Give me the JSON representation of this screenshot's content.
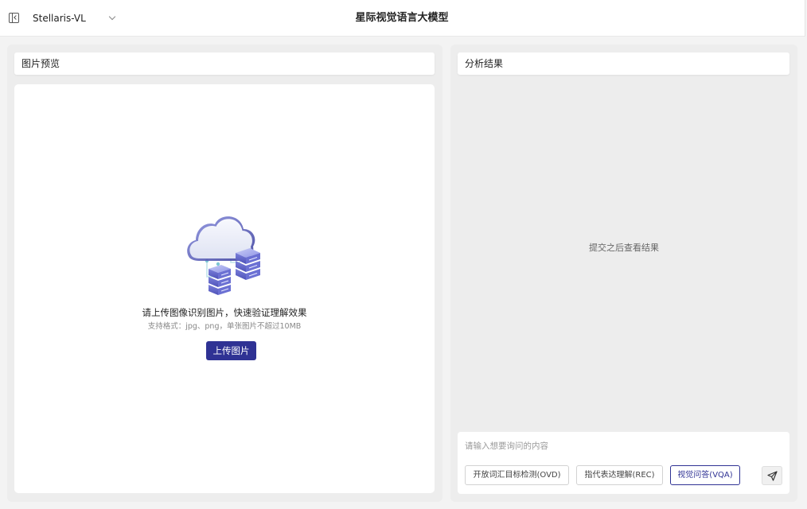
{
  "header": {
    "model_name": "Stellaris-VL",
    "title": "星际视觉语言大模型"
  },
  "left_panel": {
    "title": "图片预览",
    "upload_hint": "请上传图像识别图片，快速验证理解效果",
    "format_hint": "支持格式：jpg、png，单张图片不超过10MB",
    "upload_button": "上传图片"
  },
  "right_panel": {
    "title": "分析结果",
    "placeholder": "提交之后查看结果",
    "query_placeholder": "请输入想要询问的内容",
    "modes": [
      {
        "label": "开放词汇目标检测(OVD)",
        "selected": false
      },
      {
        "label": "指代表达理解(REC)",
        "selected": false
      },
      {
        "label": "视觉问答(VQA)",
        "selected": true
      }
    ]
  },
  "icons": {
    "toggle": "sidebar-toggle-icon",
    "dropdown": "chevron-down-icon",
    "illustration": "cloud-server-illustration",
    "send": "send-icon"
  },
  "colors": {
    "accent": "#2f3294",
    "panel_bg": "#ededed",
    "surface": "#ffffff"
  }
}
